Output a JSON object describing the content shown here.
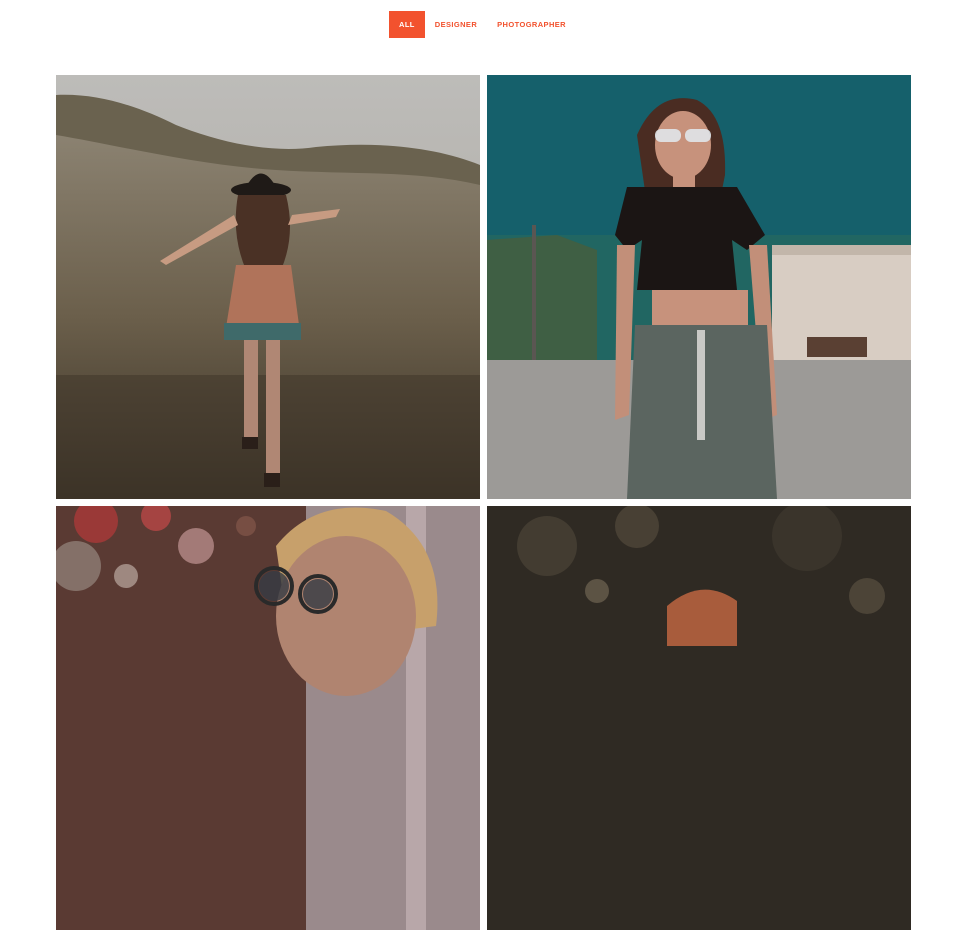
{
  "filters": {
    "items": [
      {
        "label": "ALL",
        "active": true
      },
      {
        "label": "DESIGNER",
        "active": false
      },
      {
        "label": "PHOTOGRAPHER",
        "active": false
      }
    ]
  },
  "gallery": {
    "items": [
      {
        "subject": "woman-in-field"
      },
      {
        "subject": "woman-in-sunglasses-parking-lot"
      },
      {
        "subject": "man-with-sunglasses-bokeh"
      },
      {
        "subject": "portrait-dark-bokeh"
      }
    ]
  },
  "colors": {
    "accent": "#f2522e",
    "background": "#ffffff"
  }
}
